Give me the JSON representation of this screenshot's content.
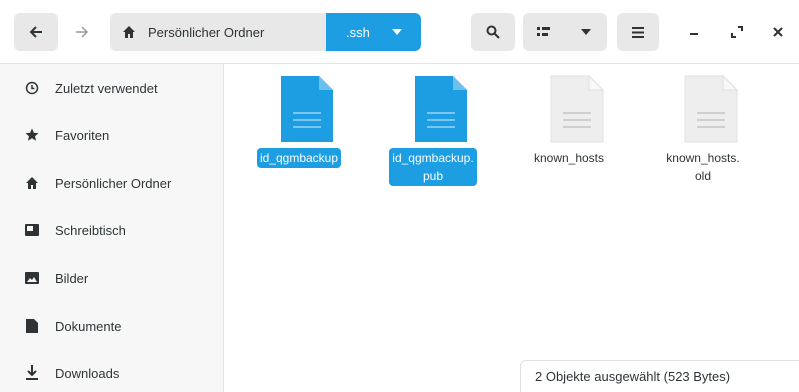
{
  "header": {
    "path": {
      "home_label": "Persönlicher Ordner",
      "current_label": ".ssh"
    }
  },
  "sidebar": {
    "items": [
      {
        "label": "Zuletzt verwendet",
        "icon": "clock-icon"
      },
      {
        "label": "Favoriten",
        "icon": "star-icon"
      },
      {
        "label": "Persönlicher Ordner",
        "icon": "home-icon"
      },
      {
        "label": "Schreibtisch",
        "icon": "desktop-icon"
      },
      {
        "label": "Bilder",
        "icon": "picture-icon"
      },
      {
        "label": "Dokumente",
        "icon": "document-icon"
      },
      {
        "label": "Downloads",
        "icon": "download-icon"
      }
    ]
  },
  "files": [
    {
      "name": "id_qgmbackup",
      "selected": true,
      "color": "#1d9de2"
    },
    {
      "name": "id_qgmbackup.\npub",
      "selected": true,
      "color": "#1d9de2"
    },
    {
      "name": "known_hosts",
      "selected": false,
      "color": "#eeeeee"
    },
    {
      "name": "known_hosts.\nold",
      "selected": false,
      "color": "#eeeeee"
    }
  ],
  "status": {
    "text": "2 Objekte ausgewählt  (523 Bytes)"
  },
  "colors": {
    "accent": "#1d9de2",
    "sidebar_bg": "#f7f7f7"
  }
}
